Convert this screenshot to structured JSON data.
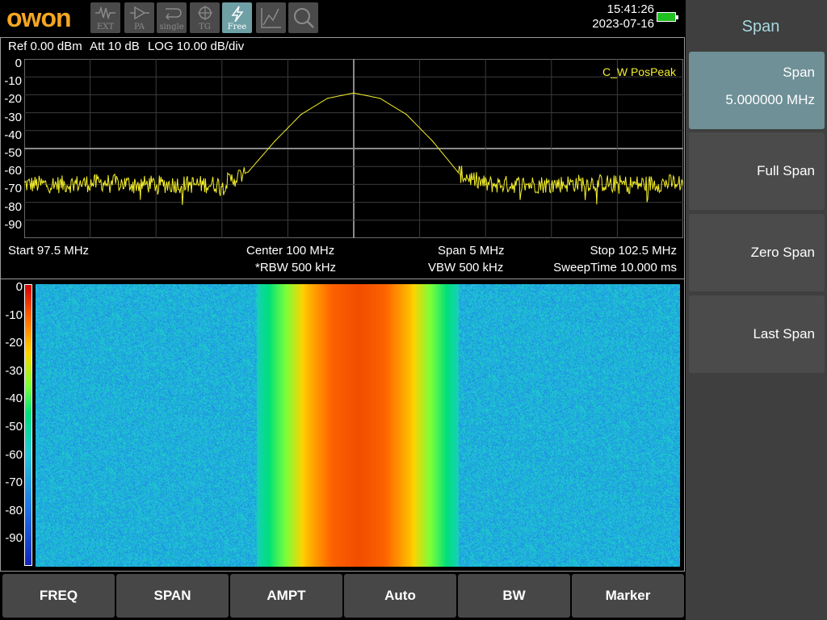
{
  "brand": {
    "logo": "owon",
    "logo_color": "#f5a623"
  },
  "toolbar": [
    {
      "name": "ext-button",
      "label": "EXT",
      "icon": "pulse-icon",
      "active": false
    },
    {
      "name": "pa-button",
      "label": "PA",
      "icon": "amplifier-icon",
      "active": false
    },
    {
      "name": "single-button",
      "label": "single",
      "icon": "single-sweep-icon",
      "active": false
    },
    {
      "name": "tg-button",
      "label": "TG",
      "icon": "tracking-generator-icon",
      "active": false
    },
    {
      "name": "free-button",
      "label": "Free",
      "icon": "lightning-icon",
      "active": true
    },
    {
      "name": "peak-button",
      "label": "",
      "icon": "peak-search-icon",
      "active": false
    },
    {
      "name": "zoom-button",
      "label": "",
      "icon": "magnifier-icon",
      "active": false
    }
  ],
  "status": {
    "time": "15:41:26",
    "date": "2023-07-16",
    "battery_icon": "battery-charging-icon"
  },
  "info": {
    "ref": "Ref 0.00 dBm",
    "att": "Att 10 dB",
    "scale": "LOG 10.00 dB/div"
  },
  "spectrum": {
    "y_labels": [
      "0",
      "-10",
      "-20",
      "-30",
      "-40",
      "-50",
      "-60",
      "-70",
      "-80",
      "-90"
    ],
    "trace_label": "C_W PosPeak",
    "trace_color": "#f5f028",
    "start": "Start 97.5 MHz",
    "center": "Center 100 MHz",
    "span": "Span 5 MHz",
    "stop": "Stop 102.5 MHz",
    "rbw": "*RBW 500 kHz",
    "vbw": "VBW 500 kHz",
    "sweep": "SweepTime 10.000 ms"
  },
  "chart_data": {
    "type": "line",
    "title": "",
    "xlabel": "",
    "ylabel": "",
    "x_range_mhz": [
      97.5,
      102.5
    ],
    "ylim": [
      -100,
      0
    ],
    "series": [
      {
        "x": [
          97.5,
          97.8,
          98.1,
          98.4,
          98.7,
          99.0,
          99.2,
          99.4,
          99.6,
          99.8,
          100.0,
          100.2,
          100.4,
          100.6,
          100.8,
          101.0,
          101.2,
          101.5,
          101.8,
          102.1,
          102.5
        ],
        "values": [
          -70,
          -70,
          -69,
          -70,
          -70,
          -70,
          -63,
          -46,
          -31,
          -22,
          -19,
          -22,
          -31,
          -46,
          -64,
          -70,
          -70,
          -70,
          -69,
          -70,
          -69
        ]
      }
    ]
  },
  "waterfall": {
    "scale_labels": [
      "0",
      "-10",
      "-20",
      "-30",
      "-40",
      "-50",
      "-60",
      "-70",
      "-80",
      "-90"
    ]
  },
  "bottom_menu": [
    "FREQ",
    "SPAN",
    "AMPT",
    "Auto",
    "BW",
    "Marker"
  ],
  "right_menu": {
    "title": "Span",
    "items": [
      {
        "label": "Span",
        "value": "5.000000 MHz",
        "selected": true
      },
      {
        "label": "Full Span",
        "value": "",
        "selected": false
      },
      {
        "label": "Zero Span",
        "value": "",
        "selected": false
      },
      {
        "label": "Last Span",
        "value": "",
        "selected": false
      }
    ]
  }
}
